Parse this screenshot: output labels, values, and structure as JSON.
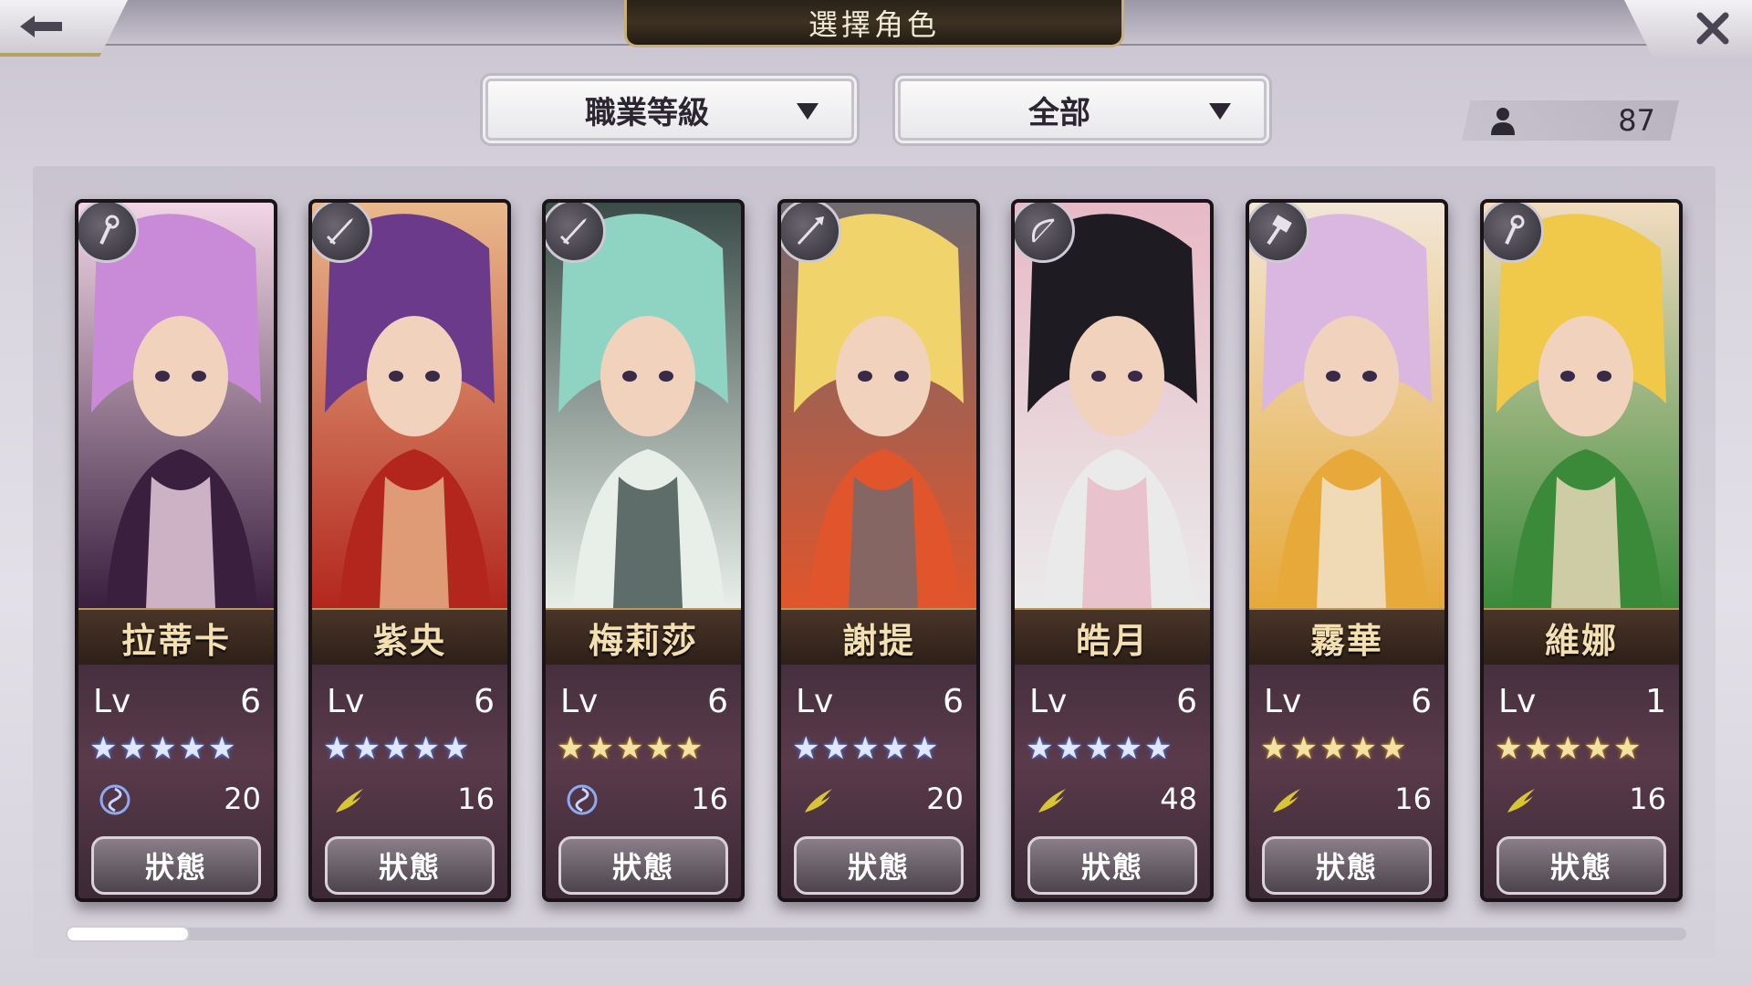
{
  "header": {
    "title": "選擇角色",
    "back_icon": "back-arrow-icon",
    "close_icon": "close-icon"
  },
  "filters": {
    "sort_label": "職業等級",
    "filter_label": "全部"
  },
  "roster": {
    "count": "87",
    "count_icon": "user-icon"
  },
  "colors": {
    "accent_gold": "#c9b07a",
    "name_text": "#f3dfb0",
    "star_blue": "#5e8cff",
    "star_gold": "#c99b34"
  },
  "characters": [
    {
      "name": "拉蒂卡",
      "lv_label": "Lv",
      "level": "6",
      "stars": 5,
      "star_color": "blue",
      "element_icon": "swirl-icon",
      "value": "20",
      "status_label": "狀態",
      "class_icon": "staff-icon",
      "palette": [
        "#c98ad8",
        "#3a1f3e",
        "#f2d6e6"
      ]
    },
    {
      "name": "紫央",
      "lv_label": "Lv",
      "level": "6",
      "stars": 5,
      "star_color": "blue",
      "element_icon": "wing-icon",
      "value": "16",
      "status_label": "狀態",
      "class_icon": "sword-icon",
      "palette": [
        "#6b3a8a",
        "#b3261e",
        "#e9b98c"
      ]
    },
    {
      "name": "梅莉莎",
      "lv_label": "Lv",
      "level": "6",
      "stars": 5,
      "star_color": "gold",
      "element_icon": "swirl-icon",
      "value": "16",
      "status_label": "狀態",
      "class_icon": "sword-icon",
      "palette": [
        "#8fd4c2",
        "#e8efe9",
        "#3b4c48"
      ]
    },
    {
      "name": "謝提",
      "lv_label": "Lv",
      "level": "6",
      "stars": 5,
      "star_color": "blue",
      "element_icon": "wing-icon",
      "value": "20",
      "status_label": "狀態",
      "class_icon": "spear-icon",
      "palette": [
        "#f0d36a",
        "#e0552b",
        "#6f6a70"
      ]
    },
    {
      "name": "皓月",
      "lv_label": "Lv",
      "level": "6",
      "stars": 5,
      "star_color": "blue",
      "element_icon": "wing-icon",
      "value": "48",
      "status_label": "狀態",
      "class_icon": "bow-icon",
      "palette": [
        "#1e1c22",
        "#eaeaea",
        "#e7b9c6"
      ]
    },
    {
      "name": "霧華",
      "lv_label": "Lv",
      "level": "6",
      "stars": 5,
      "star_color": "gold",
      "element_icon": "wing-icon",
      "value": "16",
      "status_label": "狀態",
      "class_icon": "hammer-icon",
      "palette": [
        "#d9b7e0",
        "#e6a93a",
        "#f2e6d6"
      ]
    },
    {
      "name": "維娜",
      "lv_label": "Lv",
      "level": "1",
      "stars": 5,
      "star_color": "gold",
      "element_icon": "wing-icon",
      "value": "16",
      "status_label": "狀態",
      "class_icon": "staff-icon",
      "palette": [
        "#f0c94a",
        "#3a8a3a",
        "#f3dcc0"
      ]
    }
  ],
  "scroll": {
    "position": 0.0
  }
}
